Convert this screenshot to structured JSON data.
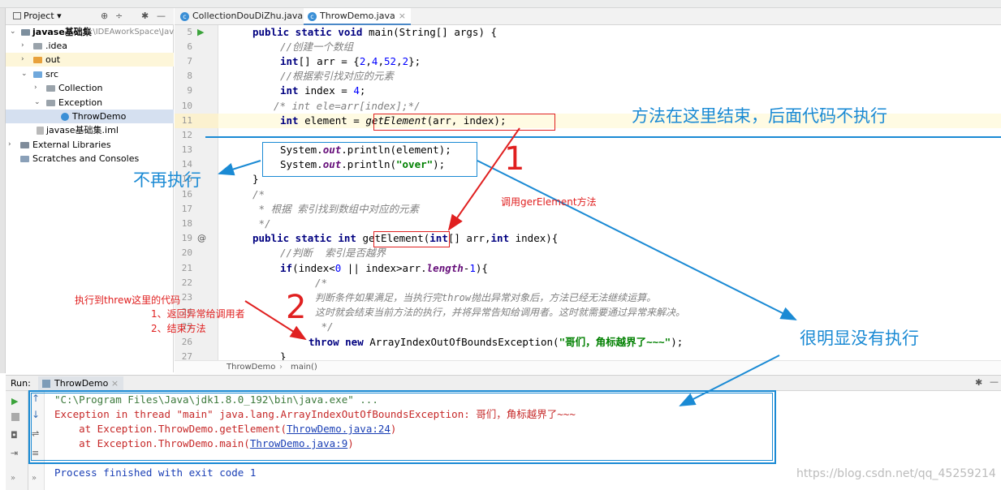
{
  "tabs": [
    {
      "label": "CollectionDouDiZhu.java",
      "close": "×"
    },
    {
      "label": "ThrowDemo.java",
      "close": "×"
    }
  ],
  "project": {
    "header": "Project",
    "tree": [
      {
        "name": "javase基础集",
        "path": "F:\\IDEAworkSpace\\Jav"
      },
      {
        "name": ".idea"
      },
      {
        "name": "out"
      },
      {
        "name": "src"
      },
      {
        "name": "Collection"
      },
      {
        "name": "Exception"
      },
      {
        "name": "ThrowDemo"
      },
      {
        "name": "javase基础集.iml"
      },
      {
        "name": "External Libraries"
      },
      {
        "name": "Scratches and Consoles"
      }
    ]
  },
  "editor": {
    "line_numbers": [
      "5",
      "6",
      "7",
      "8",
      "9",
      "10",
      "11",
      "12",
      "13",
      "14",
      "15",
      "16",
      "17",
      "18",
      "19",
      "20",
      "21",
      "22",
      "23",
      "24",
      "25",
      "26",
      "27"
    ],
    "lines": {
      "l5a": "public static void",
      "l5b": " main(String[] args) {",
      "l6": "//创建一个数组",
      "l7a": "int",
      "l7b": "[] arr = {",
      "l7c": "2",
      "l7d": ",",
      "l7e": "4",
      "l7f": ",",
      "l7g": "52",
      "l7h": ",",
      "l7i": "2",
      "l7j": "};",
      "l8": "//根据索引找对应的元素",
      "l9a": "int",
      "l9b": " index = ",
      "l9c": "4",
      "l9d": ";",
      "l10": "/* int ele=arr[index];*/",
      "l11a": "int",
      "l11b": " element = ",
      "l11c": "getElement",
      "l11d": "(arr, index);",
      "l13a": "System.",
      "l13b": "out",
      "l13c": ".println(element);",
      "l14a": "System.",
      "l14b": "out",
      "l14c": ".println(",
      "l14d": "\"over\"",
      "l14e": ");",
      "l15": "}",
      "l16": "/*",
      "l17": " * 根据 索引找到数组中对应的元素",
      "l18": " */",
      "l19a": "public static int",
      "l19b": " getElement",
      "l19c": "(",
      "l19d": "int",
      "l19e": "[] arr,",
      "l19f": "int",
      "l19g": " index){",
      "l20": "//判断  索引是否越界",
      "l21a": "if",
      "l21b": "(index<",
      "l21c": "0",
      "l21d": " || index>arr.",
      "l21e": "length",
      "l21f": "-",
      "l21g": "1",
      "l21h": "){",
      "l22": "/*",
      "l23": "判断条件如果满足，当执行完throw抛出异常对象后，方法已经无法继续运算。",
      "l24": "这时就会结束当前方法的执行，并将异常告知给调用者。这时就需要通过异常来解决。",
      "l25": " */",
      "l26a": "throw new",
      "l26b": " ArrayIndexOutOfBoundsException(",
      "l26c": "\"哥们，角标越界了~~~\"",
      "l26d": ");",
      "l27": "}"
    },
    "breadcrumb": [
      "ThrowDemo",
      "main()"
    ]
  },
  "run": {
    "label": "Run:",
    "tab": "ThrowDemo",
    "console": [
      "\"C:\\Program Files\\Java\\jdk1.8.0_192\\bin\\java.exe\" ...",
      "Exception in thread \"main\" java.lang.ArrayIndexOutOfBoundsException: 哥们，角标越界了~~~",
      "    at Exception.ThrowDemo.getElement(",
      "ThrowDemo.java:24",
      ")",
      "    at Exception.ThrowDemo.main(",
      "ThrowDemo.java:9",
      ")",
      "Process finished with exit code 1"
    ]
  },
  "annotations": {
    "method_ends": "方法在这里结束，后面代码不执行",
    "no_longer": "不再执行",
    "num1": "1",
    "call_get": "调用gerElement方法",
    "num2": "2",
    "throw_reached": "执行到threw这里的代码",
    "step1": "1、返回异常给调用者",
    "step2": "2、结束方法",
    "clearly_not": "很明显没有执行"
  },
  "watermark": "https://blog.csdn.net/qq_45259214",
  "colors": {
    "red_annot": "#e02020",
    "blue_annot": "#1a8ad4",
    "accent": "#4a88c7"
  }
}
